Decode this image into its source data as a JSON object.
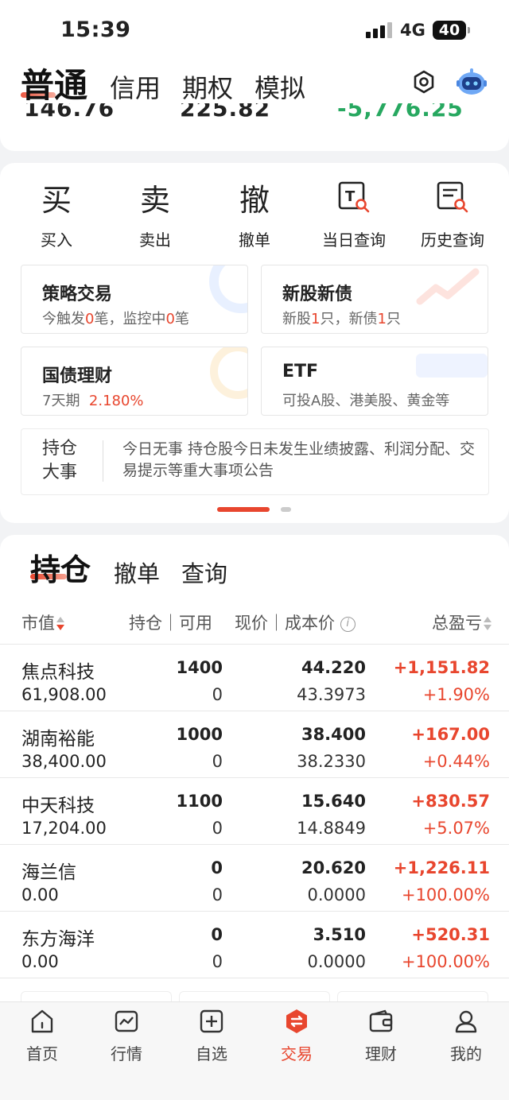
{
  "status_bar": {
    "time": "15:39",
    "network": "4G",
    "battery": "40"
  },
  "top_tabs": {
    "active": "普通",
    "items": [
      "信用",
      "期权",
      "模拟"
    ]
  },
  "summary_partial": [
    "146.76",
    "225.82",
    "-5,776.25"
  ],
  "quick_actions": [
    {
      "glyph": "买",
      "label": "买入"
    },
    {
      "glyph": "卖",
      "label": "卖出"
    },
    {
      "glyph": "撤",
      "label": "撤单"
    },
    {
      "glyph": "T",
      "label": "当日查询"
    },
    {
      "glyph": "≡",
      "label": "历史查询"
    }
  ],
  "tiles": {
    "strategy": {
      "title": "策略交易",
      "s1": "今触发",
      "n1": "0",
      "s2": "笔，监控中",
      "n2": "0",
      "s3": "笔"
    },
    "ipo": {
      "title": "新股新债",
      "s1": "新股",
      "n1": "1",
      "s2": "只，新债",
      "n2": "1",
      "s3": "只"
    },
    "bond": {
      "title": "国债理财",
      "term": "7天期",
      "rate": "2.180%"
    },
    "etf": {
      "title": "ETF",
      "desc": "可投A股、港美股、黄金等"
    }
  },
  "news": {
    "tag": "持仓大事",
    "text": "今日无事 持仓股今日未发生业绩披露、利润分配、交易提示等重大事项公告"
  },
  "holding_tabs": {
    "active": "持仓",
    "items": [
      "撤单",
      "查询"
    ]
  },
  "table_header": {
    "market_value": "市值",
    "position": "持仓｜可用",
    "price": "现价｜成本价",
    "info": "i",
    "pnl": "总盈亏"
  },
  "holdings": [
    {
      "name": "焦点科技",
      "market_value": "61,908.00",
      "qty": "1400",
      "avail": "0",
      "price": "44.220",
      "cost": "43.3973",
      "pnl": "+1,151.82",
      "pnl_pct": "+1.90%"
    },
    {
      "name": "湖南裕能",
      "market_value": "38,400.00",
      "qty": "1000",
      "avail": "0",
      "price": "38.400",
      "cost": "38.2330",
      "pnl": "+167.00",
      "pnl_pct": "+0.44%"
    },
    {
      "name": "中天科技",
      "market_value": "17,204.00",
      "qty": "1100",
      "avail": "0",
      "price": "15.640",
      "cost": "14.8849",
      "pnl": "+830.57",
      "pnl_pct": "+5.07%"
    },
    {
      "name": "海兰信",
      "market_value": "0.00",
      "qty": "0",
      "avail": "0",
      "price": "20.620",
      "cost": "0.0000",
      "pnl": "+1,226.11",
      "pnl_pct": "+100.00%"
    },
    {
      "name": "东方海洋",
      "market_value": "0.00",
      "qty": "0",
      "avail": "0",
      "price": "3.510",
      "cost": "0.0000",
      "pnl": "+520.31",
      "pnl_pct": "+100.00%"
    }
  ],
  "bottom_nav": [
    "首页",
    "行情",
    "自选",
    "交易",
    "理财",
    "我的"
  ],
  "colors": {
    "accent": "#e8462e",
    "loss": "#27a860"
  }
}
